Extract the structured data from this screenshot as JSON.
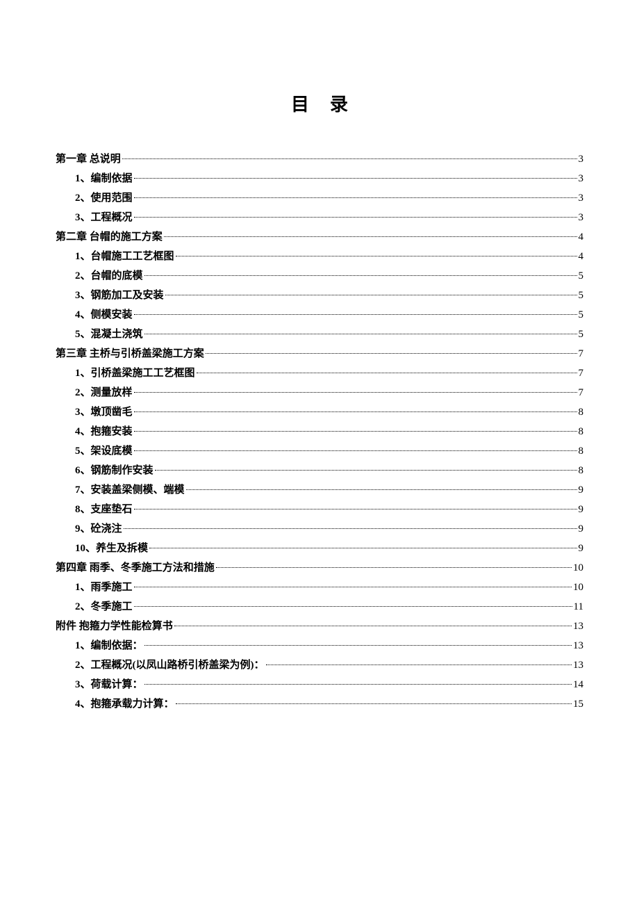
{
  "title": "目录",
  "toc": [
    {
      "level": 0,
      "label": "第一章  总说明",
      "page": "3"
    },
    {
      "level": 1,
      "label": "1、编制依据",
      "page": "3"
    },
    {
      "level": 1,
      "label": "2、使用范围",
      "page": "3"
    },
    {
      "level": 1,
      "label": "3、工程概况",
      "page": "3"
    },
    {
      "level": 0,
      "label": "第二章  台帽的施工方案",
      "page": "4"
    },
    {
      "level": 1,
      "label": "1、台帽施工工艺框图",
      "page": "4"
    },
    {
      "level": 1,
      "label": "2、台帽的底模",
      "page": "5"
    },
    {
      "level": 1,
      "label": "3、钢筋加工及安装",
      "page": "5"
    },
    {
      "level": 1,
      "label": "4、侧模安装",
      "page": "5"
    },
    {
      "level": 1,
      "label": "5、混凝土浇筑",
      "page": "5"
    },
    {
      "level": 0,
      "label": "第三章  主桥与引桥盖梁施工方案",
      "page": "7"
    },
    {
      "level": 1,
      "label": "1、引桥盖梁施工工艺框图",
      "page": "7"
    },
    {
      "level": 1,
      "label": "2、测量放样",
      "page": "7"
    },
    {
      "level": 1,
      "label": "3、墩顶凿毛",
      "page": "8"
    },
    {
      "level": 1,
      "label": "4、抱箍安装",
      "page": "8"
    },
    {
      "level": 1,
      "label": "5、架设底模",
      "page": "8"
    },
    {
      "level": 1,
      "label": "6、钢筋制作安装",
      "page": "8"
    },
    {
      "level": 1,
      "label": "7、安装盖梁侧模、端模",
      "page": "9"
    },
    {
      "level": 1,
      "label": "8、支座垫石",
      "page": "9"
    },
    {
      "level": 1,
      "label": "9、砼浇注",
      "page": "9"
    },
    {
      "level": 1,
      "label": "10、养生及拆模",
      "page": "9"
    },
    {
      "level": 0,
      "label": "第四章  雨季、冬季施工方法和措施",
      "page": "10"
    },
    {
      "level": 1,
      "label": "1、雨季施工",
      "page": "10"
    },
    {
      "level": 1,
      "label": "2、冬季施工",
      "page": "11"
    },
    {
      "level": 0,
      "label": "附件    抱箍力学性能检算书",
      "page": "13"
    },
    {
      "level": 1,
      "label": "1、编制依据：",
      "page": "13"
    },
    {
      "level": 1,
      "label": "2、工程概况(以凤山路桥引桥盖梁为例)：",
      "page": "13"
    },
    {
      "level": 1,
      "label": "3、荷载计算：",
      "page": "14"
    },
    {
      "level": 1,
      "label": "4、抱箍承载力计算：",
      "page": "15"
    }
  ]
}
